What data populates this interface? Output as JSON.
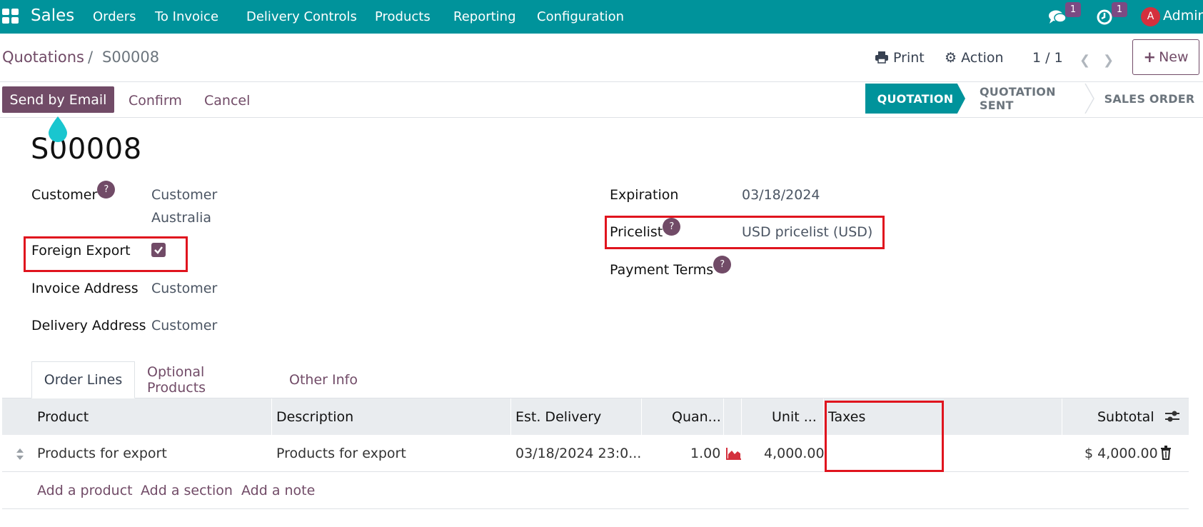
{
  "navbar": {
    "app_name": "Sales",
    "menu": [
      "Orders",
      "To Invoice",
      "Delivery Controls",
      "Products",
      "Reporting",
      "Configuration"
    ],
    "messages_count": "1",
    "activities_count": "1",
    "avatar_letter": "A",
    "user_name": "Admin",
    "bg_color": "#00939b"
  },
  "breadcrumb": {
    "parent": "Quotations",
    "separator": "/",
    "current": "S00008"
  },
  "control_panel": {
    "print_label": "Print",
    "action_label": "Action",
    "pager": "1 / 1",
    "new_label": "New"
  },
  "statusbar": {
    "send_email_label": "Send by Email",
    "confirm_label": "Confirm",
    "cancel_label": "Cancel",
    "stages": [
      "QUOTATION",
      "QUOTATION SENT",
      "SALES ORDER"
    ],
    "active_stage": "QUOTATION"
  },
  "form": {
    "title": "S00008",
    "customer_label": "Customer",
    "customer_value_line1": "Customer",
    "customer_value_line2": "Australia",
    "foreign_export_label": "Foreign Export",
    "foreign_export_checked": true,
    "invoice_address_label": "Invoice Address",
    "invoice_address_value": "Customer",
    "delivery_address_label": "Delivery Address",
    "delivery_address_value": "Customer",
    "expiration_label": "Expiration",
    "expiration_value": "03/18/2024",
    "pricelist_label": "Pricelist",
    "pricelist_value": "USD pricelist (USD)",
    "payment_terms_label": "Payment Terms",
    "help_glyph": "?"
  },
  "tabs": [
    "Order Lines",
    "Optional Products",
    "Other Info"
  ],
  "order_lines": {
    "headers": {
      "product": "Product",
      "description": "Description",
      "est_delivery": "Est. Delivery",
      "quantity": "Quan...",
      "unit_price": "Unit ...",
      "taxes": "Taxes",
      "subtotal": "Subtotal"
    },
    "rows": [
      {
        "product": "Products for export",
        "description": "Products for export",
        "est_delivery": "03/18/2024 23:0...",
        "quantity": "1.00",
        "unit_price": "4,000.00",
        "taxes": "",
        "subtotal": "$ 4,000.00"
      }
    ],
    "add_product": "Add a product",
    "add_section": "Add a section",
    "add_note": "Add a note"
  },
  "colors": {
    "brand": "#714b67",
    "teal": "#00939b",
    "highlight": "#e0141e"
  }
}
